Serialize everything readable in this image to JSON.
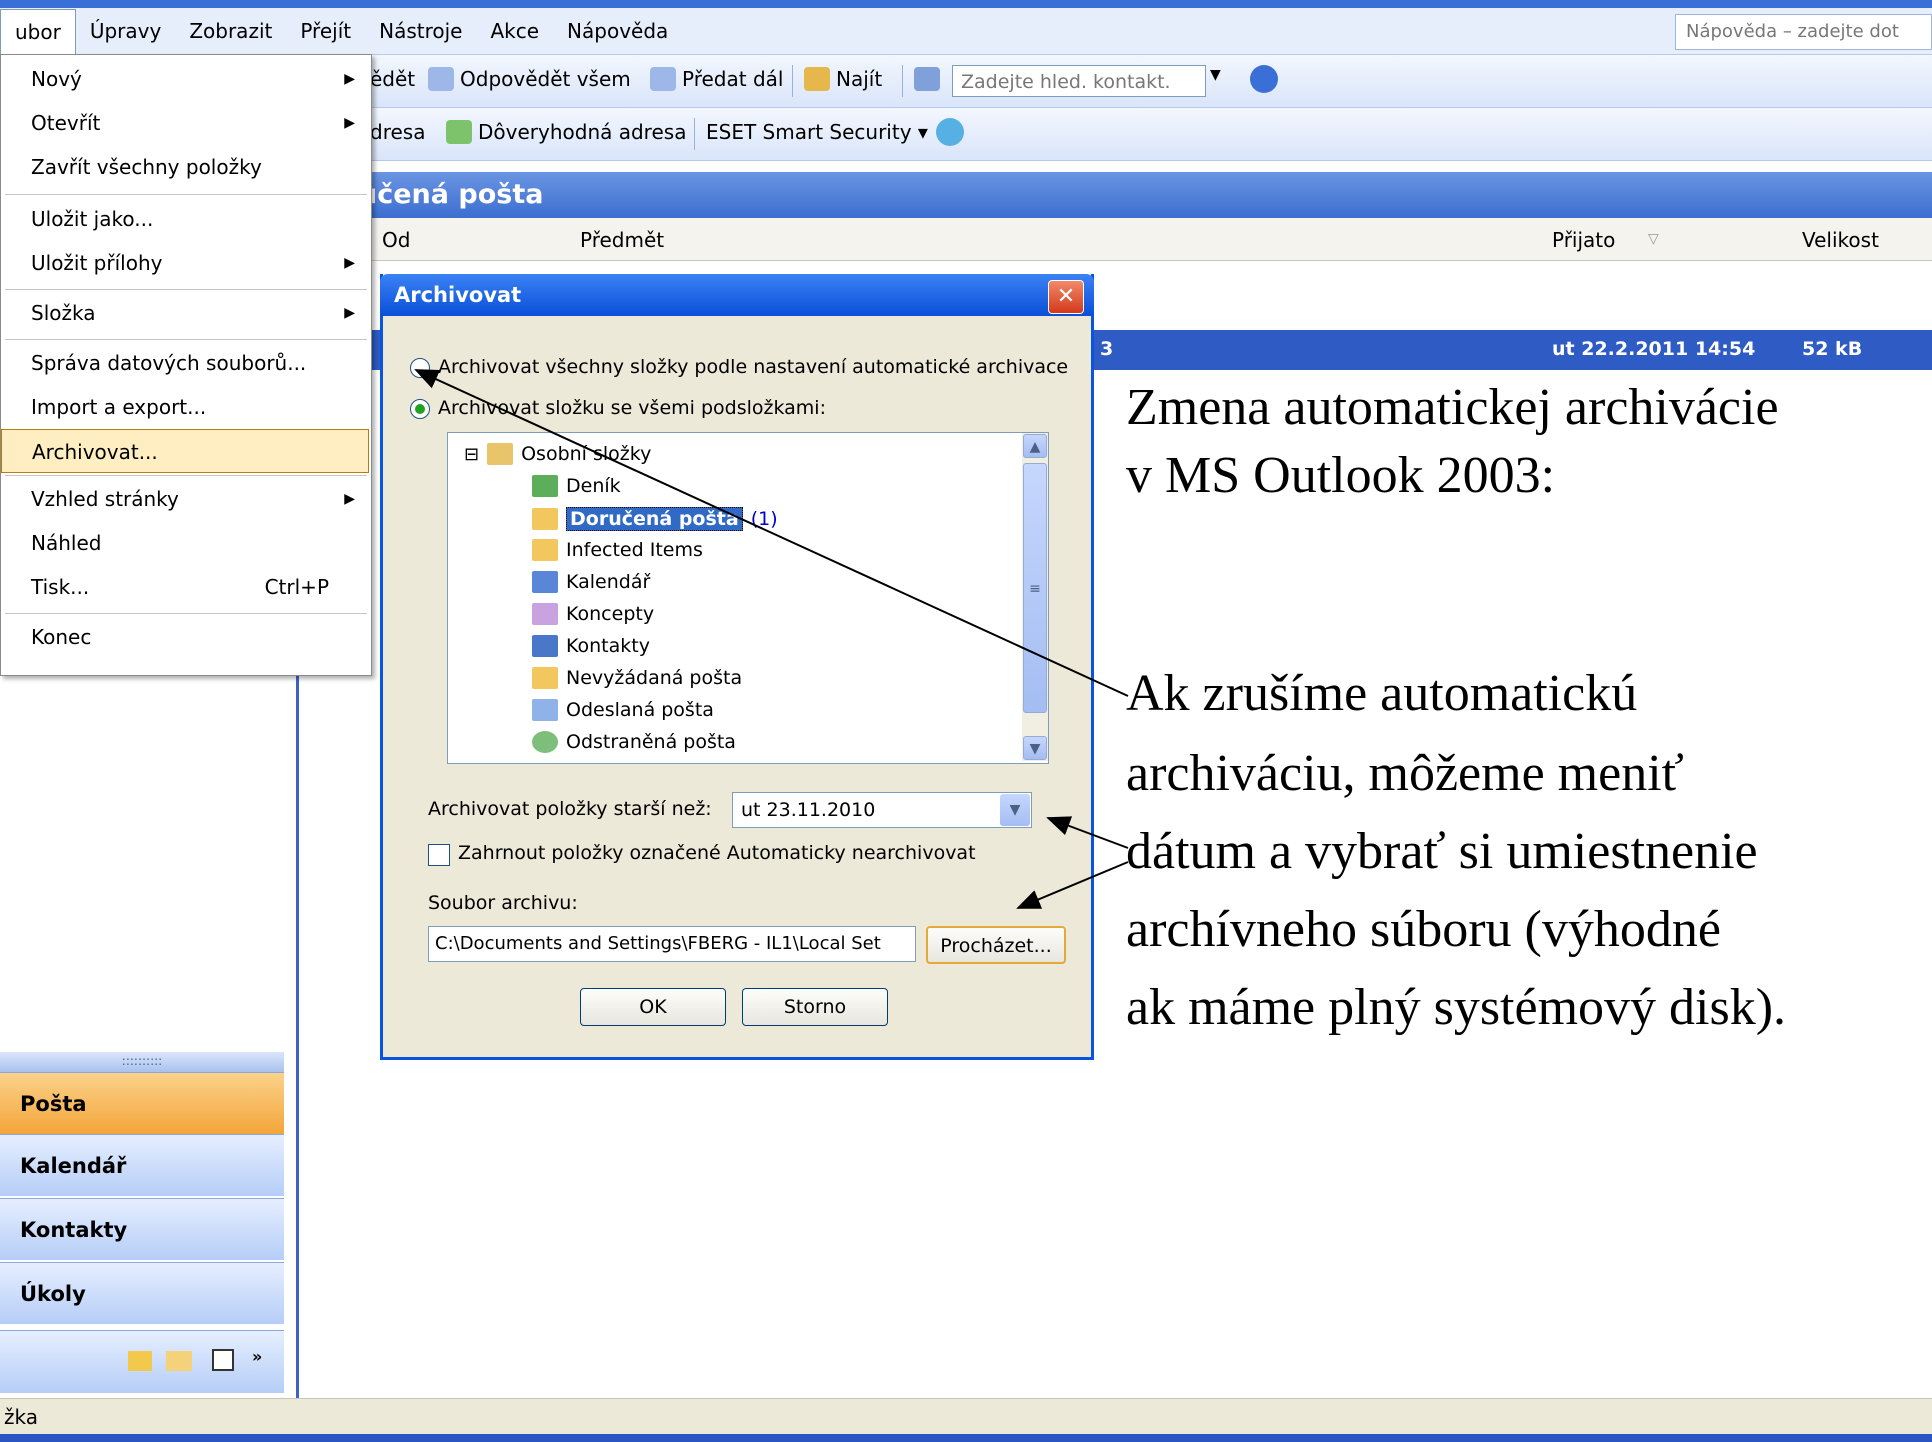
{
  "menubar": {
    "items": [
      "ubor",
      "Úpravy",
      "Zobrazit",
      "Přejít",
      "Nástroje",
      "Akce",
      "Nápověda"
    ],
    "help_placeholder": "Nápověda – zadejte dot"
  },
  "toolbar1": {
    "reply": "ědět",
    "reply_all": "Odpovědět všem",
    "forward": "Předat dál",
    "find": "Najít",
    "contact_search": "Zadejte hled. kontakt."
  },
  "toolbar2": {
    "address": "dresa",
    "trusted": "Dôveryhodná adresa",
    "eset": "ESET Smart Security ▾"
  },
  "folder": {
    "title": "učená pošta",
    "col_from": "Od",
    "col_subject": "Předmět",
    "col_received": "Přijato",
    "col_size": "Velikost"
  },
  "selected_row": {
    "frag": "3",
    "received": "ut 22.2.2011 14:54",
    "size": "52 kB"
  },
  "file_menu": {
    "items": [
      {
        "label": "Nový",
        "arrow": "▶"
      },
      {
        "label": "Otevřít",
        "arrow": "▶"
      },
      {
        "label": "Zavřít všechny položky"
      },
      {
        "label": "Uložit jako..."
      },
      {
        "label": "Uložit přílohy",
        "arrow": "▶"
      },
      {
        "label": "Složka",
        "arrow": "▶"
      },
      {
        "label": "Správa datových souborů..."
      },
      {
        "label": "Import a export..."
      },
      {
        "label": "Archivovat..."
      },
      {
        "label": "Vzhled stránky",
        "arrow": "▶"
      },
      {
        "label": "Náhled"
      },
      {
        "label": "Tisk...",
        "shortcut": "Ctrl+P"
      },
      {
        "label": "Konec"
      }
    ]
  },
  "nav": {
    "mail": "Pošta",
    "calendar": "Kalendář",
    "contacts": "Kontakty",
    "tasks": "Úkoly",
    "grip": "::::::::::"
  },
  "status": {
    "text": "žka"
  },
  "dialog": {
    "title": "Archivovat",
    "close": "✕",
    "radio_all": "Archivovat všechny složky podle nastavení automatické archivace",
    "radio_folder": "Archivovat složku se všemi podsložkami:",
    "tree": {
      "root": "Osobní složky",
      "items": [
        "Deník",
        "Doručená pošta",
        "Infected Items",
        "Kalendář",
        "Koncepty",
        "Kontakty",
        "Nevyžádaná pošta",
        "Odeslaná pošta",
        "Odstraněná pošta"
      ],
      "unread": "(1)",
      "expander": "⊟"
    },
    "older_label": "Archivovat položky starší než:",
    "older_value": "ut 23.11.2010",
    "include_label": "Zahrnout položky označené Automaticky nearchivovat",
    "file_label": "Soubor archivu:",
    "file_path": "C:\\Documents and Settings\\FBERG - IL1\\Local Set",
    "browse": "Procházet...",
    "ok": "OK",
    "cancel": "Storno"
  },
  "annotation": {
    "line1": "Zmena automatickej archivácie",
    "line2": "v MS Outlook 2003:",
    "line3": "Ak zrušíme automatickú",
    "line4": "archiváciu, môžeme meniť",
    "line5": "dátum a vybrať si umiestnenie",
    "line6": "archívneho súboru (výhodné",
    "line7": "ak máme plný systémový disk)."
  },
  "colors": {
    "accent": "#0a55e0",
    "highlight": "#ffeec2",
    "nav_active": "#f3a53a"
  }
}
